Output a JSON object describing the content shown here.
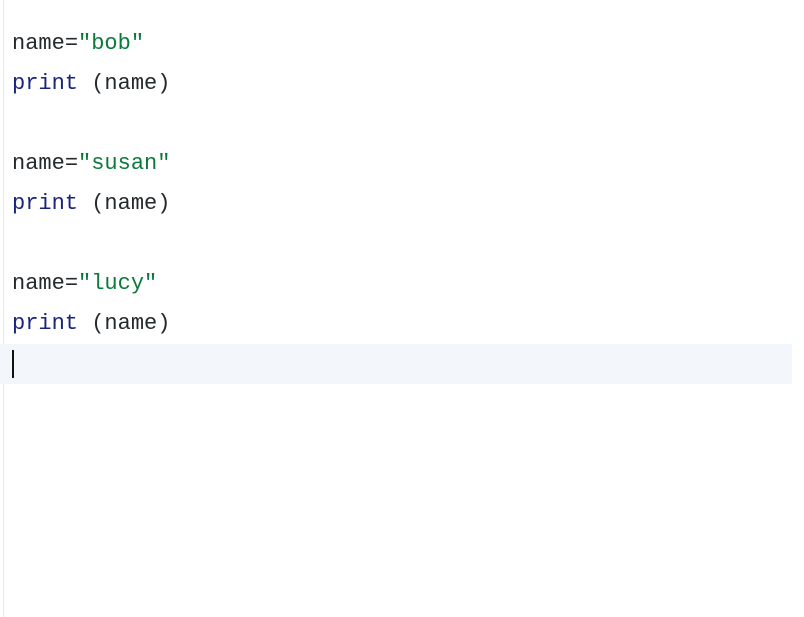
{
  "code": {
    "lines": [
      {
        "tokens": [
          {
            "t": "name",
            "c": "var"
          },
          {
            "t": "=",
            "c": "op"
          },
          {
            "t": "\"bob\"",
            "c": "str"
          }
        ]
      },
      {
        "tokens": [
          {
            "t": "print",
            "c": "builtin"
          },
          {
            "t": " ",
            "c": "default"
          },
          {
            "t": "(",
            "c": "punct"
          },
          {
            "t": "name",
            "c": "var"
          },
          {
            "t": ")",
            "c": "punct"
          }
        ]
      },
      {
        "tokens": []
      },
      {
        "tokens": [
          {
            "t": "name",
            "c": "var"
          },
          {
            "t": "=",
            "c": "op"
          },
          {
            "t": "\"susan\"",
            "c": "str"
          }
        ]
      },
      {
        "tokens": [
          {
            "t": "print",
            "c": "builtin"
          },
          {
            "t": " ",
            "c": "default"
          },
          {
            "t": "(",
            "c": "punct"
          },
          {
            "t": "name",
            "c": "var"
          },
          {
            "t": ")",
            "c": "punct"
          }
        ]
      },
      {
        "tokens": []
      },
      {
        "tokens": [
          {
            "t": "name",
            "c": "var"
          },
          {
            "t": "=",
            "c": "op"
          },
          {
            "t": "\"lucy\"",
            "c": "str"
          }
        ]
      },
      {
        "tokens": [
          {
            "t": "print",
            "c": "builtin"
          },
          {
            "t": " ",
            "c": "default"
          },
          {
            "t": "(",
            "c": "punct"
          },
          {
            "t": "name",
            "c": "var"
          },
          {
            "t": ")",
            "c": "punct"
          }
        ]
      },
      {
        "tokens": [],
        "current": true
      }
    ]
  }
}
